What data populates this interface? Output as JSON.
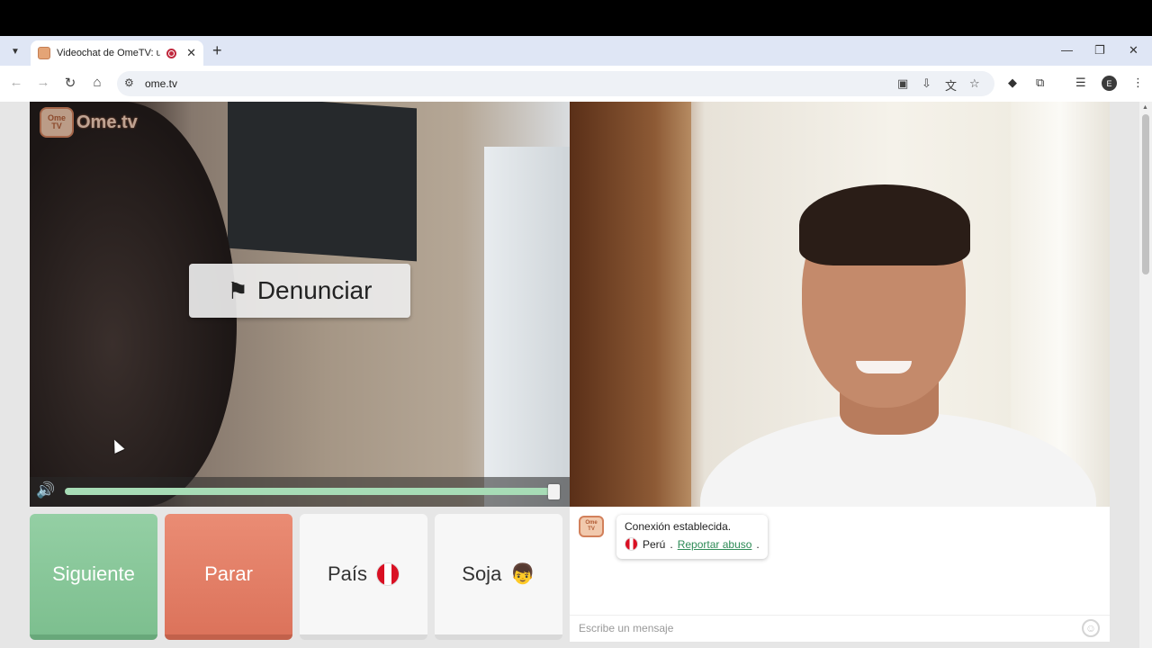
{
  "browser": {
    "tab_title": "Videochat de OmeTV: una",
    "new_tab_label": "+",
    "url": "ome.tv",
    "profile_initial": "E",
    "win_controls": {
      "minimize": "—",
      "restore": "❐",
      "close": "✕"
    }
  },
  "logo": {
    "tv_top": "Ome",
    "tv_bottom": "TV",
    "text": "Ome.tv"
  },
  "remote_video": {
    "report_label": "Denunciar",
    "volume_level_percent": 97
  },
  "buttons": {
    "next": "Siguiente",
    "stop": "Parar",
    "country": "País",
    "gender": "Soja"
  },
  "chat": {
    "logo_top": "Ome",
    "logo_bottom": "TV",
    "status_message": "Conexión establecida.",
    "country": "Perú",
    "separator": " . ",
    "report_link": "Reportar abuso",
    "period": ".",
    "input_placeholder": "Escribe un mensaje"
  },
  "icons": {
    "flag": "⚑",
    "speaker": "🔊",
    "boy": "👦",
    "smiley": "☺"
  },
  "colors": {
    "next_button": "#7dbf8f",
    "stop_button": "#dc735b",
    "link": "#2e8b57",
    "tabstrip": "#dfe6f5"
  }
}
